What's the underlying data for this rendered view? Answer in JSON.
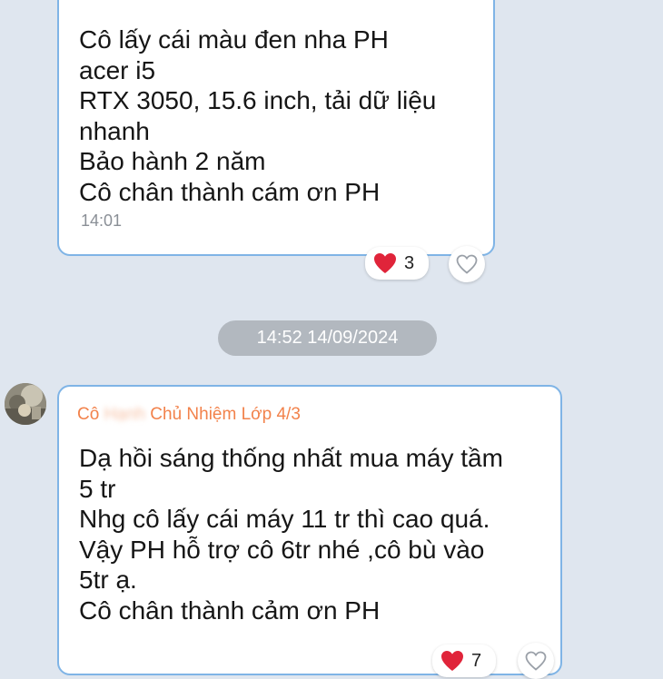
{
  "messages": [
    {
      "lines": [
        "Cô lấy cái màu đen nha PH",
        "acer i5",
        "RTX 3050, 15.6 inch, tải dữ liệu",
        "nhanh",
        "Bảo hành 2 năm",
        "Cô chân thành cám ơn PH"
      ],
      "time": "14:01",
      "reaction": {
        "icon": "heart-icon",
        "count": "3"
      }
    },
    {
      "sender": {
        "prefix": "Cô",
        "name_blurred": "Hạnh",
        "suffix": "Chủ Nhiệm Lớp 4/3"
      },
      "lines": [
        "Dạ hồi sáng thống nhất mua máy tầm",
        "5 tr",
        "Nhg cô lấy cái máy 11 tr thì cao quá.",
        "Vậy PH hỗ trợ cô 6tr nhé ,cô bù vào",
        "5tr ạ.",
        "Cô chân thành cảm ơn PH"
      ],
      "reaction": {
        "icon": "heart-icon",
        "count": "7"
      }
    }
  ],
  "date_separator": "14:52 14/09/2024",
  "colors": {
    "background": "#dfe6ef",
    "bubble_border": "#7fb4e6",
    "sender": "#f2824b",
    "heart": "#e0243a",
    "date_pill": "#b2b8bf"
  }
}
